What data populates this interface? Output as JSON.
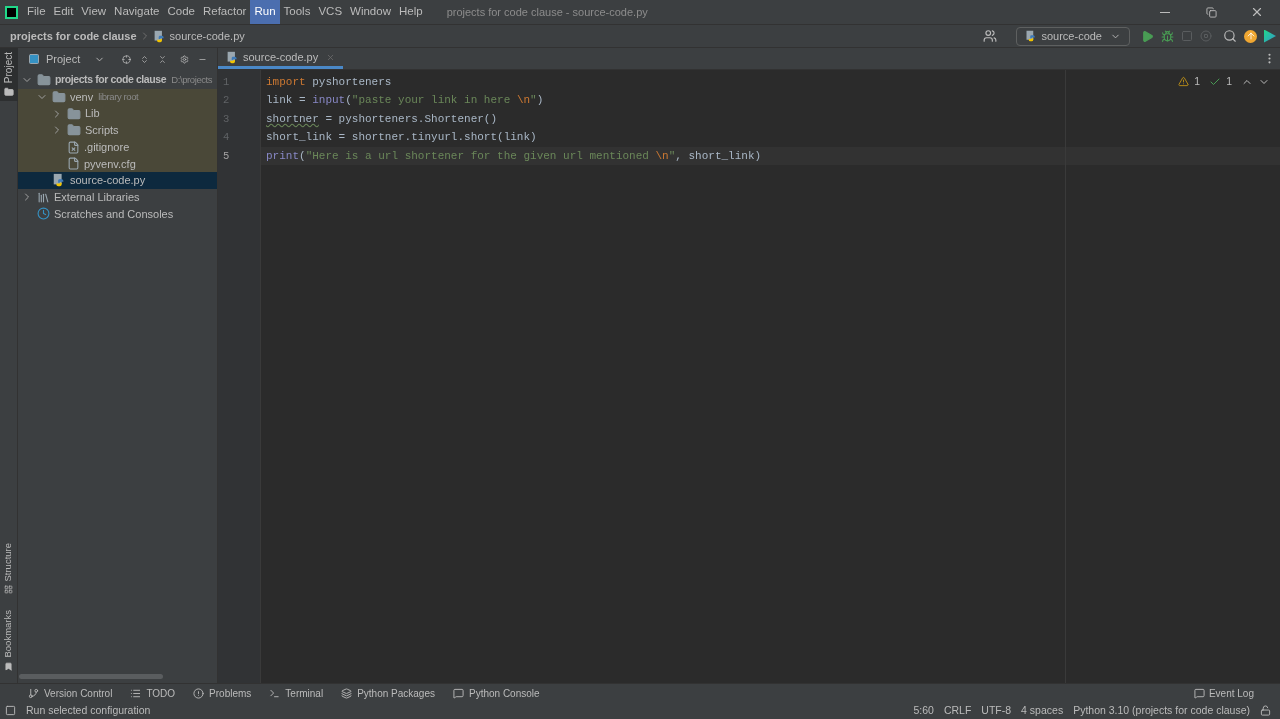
{
  "menu": [
    {
      "label": "File",
      "selected": false
    },
    {
      "label": "Edit",
      "selected": false
    },
    {
      "label": "View",
      "selected": false
    },
    {
      "label": "Navigate",
      "selected": false
    },
    {
      "label": "Code",
      "selected": false
    },
    {
      "label": "Refactor",
      "selected": false
    },
    {
      "label": "Run",
      "selected": true
    },
    {
      "label": "Tools",
      "selected": false
    },
    {
      "label": "VCS",
      "selected": false
    },
    {
      "label": "Window",
      "selected": false
    },
    {
      "label": "Help",
      "selected": false
    }
  ],
  "window": {
    "title": "projects for code clause - source-code.py"
  },
  "breadcrumbs": [
    "projects for code clause",
    "source-code.py"
  ],
  "run_config": "source-code",
  "project_panel": {
    "title": "Project",
    "tree": [
      {
        "kind": "folder",
        "label": "projects for code clause",
        "hint": "D:\\projects",
        "bold": true,
        "expanded": true,
        "selected": false,
        "children": [
          {
            "kind": "folder",
            "label": "venv",
            "hint": "library root",
            "library_root": true,
            "expanded": true,
            "selected": false,
            "children": [
              {
                "kind": "folder",
                "label": "Lib",
                "expanded": false,
                "selected": false
              },
              {
                "kind": "folder",
                "label": "Scripts",
                "expanded": false,
                "selected": false
              },
              {
                "kind": "ignore",
                "label": ".gitignore",
                "selected": false
              },
              {
                "kind": "file",
                "label": "pyvenv.cfg",
                "selected": false
              }
            ]
          },
          {
            "kind": "python",
            "label": "source-code.py",
            "selected": true
          }
        ]
      },
      {
        "kind": "library",
        "label": "External Libraries",
        "expanded": false,
        "selected": false
      },
      {
        "kind": "scratches",
        "label": "Scratches and Consoles",
        "selected": false
      }
    ]
  },
  "side_tabs": {
    "top": [
      {
        "label": "Project",
        "selected": true
      }
    ],
    "bottom": [
      {
        "label": "Structure",
        "selected": false
      },
      {
        "label": "Bookmarks",
        "selected": false
      }
    ]
  },
  "editor": {
    "tab": "source-code.py",
    "warnings": "1",
    "checks": "1",
    "lines": [
      {
        "number": "1",
        "current": false,
        "tokens": [
          {
            "kind": "keyword",
            "text": "import"
          },
          {
            "kind": "plain",
            "text": " pyshorteners"
          }
        ]
      },
      {
        "number": "2",
        "current": false,
        "tokens": [
          {
            "kind": "plain",
            "text": "link = "
          },
          {
            "kind": "builtin",
            "text": "input"
          },
          {
            "kind": "plain",
            "text": "("
          },
          {
            "kind": "string",
            "text": "\"paste your link in here "
          },
          {
            "kind": "escape",
            "text": "\\n"
          },
          {
            "kind": "string",
            "text": "\""
          },
          {
            "kind": "plain",
            "text": ")"
          }
        ]
      },
      {
        "number": "3",
        "current": false,
        "tokens": [
          {
            "kind": "warn",
            "text": "shortner"
          },
          {
            "kind": "plain",
            "text": " = pyshorteners.Shortener()"
          }
        ]
      },
      {
        "number": "4",
        "current": false,
        "tokens": [
          {
            "kind": "plain",
            "text": "short_link = shortner.tinyurl.short(link)"
          }
        ]
      },
      {
        "number": "5",
        "current": true,
        "tokens": [
          {
            "kind": "builtin",
            "text": "print"
          },
          {
            "kind": "plain",
            "text": "("
          },
          {
            "kind": "string",
            "text": "\"Here is a url shortener for the given url mentioned "
          },
          {
            "kind": "escape",
            "text": "\\n"
          },
          {
            "kind": "string",
            "text": "\""
          },
          {
            "kind": "plain",
            "text": ", short_link)"
          }
        ]
      }
    ]
  },
  "tool_tabs": [
    {
      "kind": "vcs",
      "label": "Version Control"
    },
    {
      "kind": "todo",
      "label": "TODO"
    },
    {
      "kind": "problems",
      "label": "Problems"
    },
    {
      "kind": "terminal",
      "label": "Terminal"
    },
    {
      "kind": "packages",
      "label": "Python Packages"
    },
    {
      "kind": "console",
      "label": "Python Console"
    }
  ],
  "event_log": "Event Log",
  "status_bar": {
    "message": "Run selected configuration",
    "items": [
      "5:60",
      "CRLF",
      "UTF-8",
      "4 spaces",
      "Python 3.10 (projects for code clause)"
    ]
  }
}
